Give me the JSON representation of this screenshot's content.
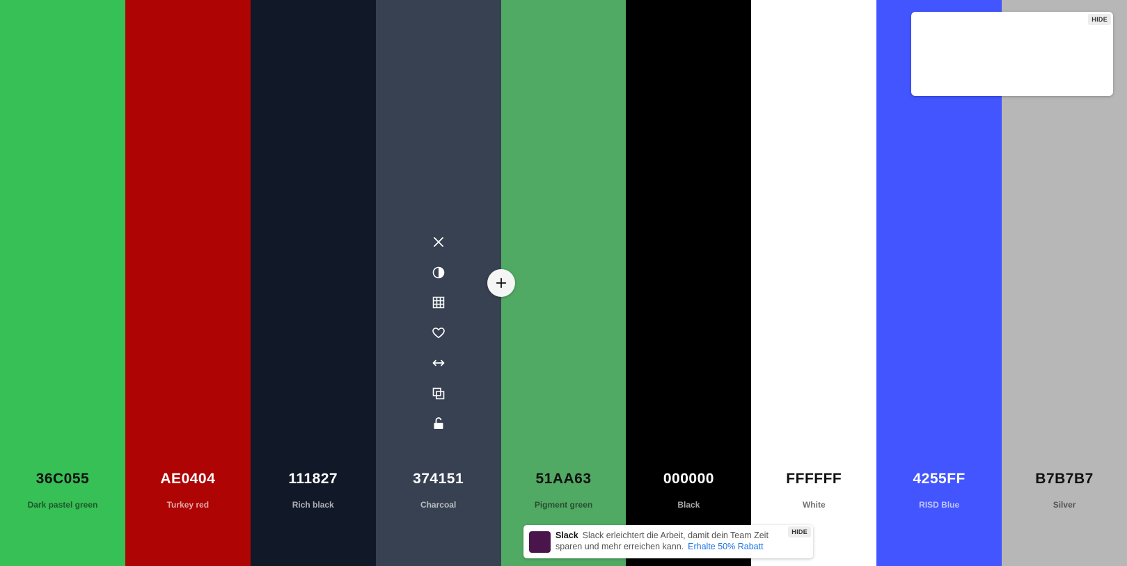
{
  "palette": {
    "swatches": [
      {
        "hex": "36C055",
        "name": "Dark pastel green",
        "color": "#36C055",
        "text": "dark"
      },
      {
        "hex": "AE0404",
        "name": "Turkey red",
        "color": "#AE0404",
        "text": "light"
      },
      {
        "hex": "111827",
        "name": "Rich black",
        "color": "#111827",
        "text": "light"
      },
      {
        "hex": "374151",
        "name": "Charcoal",
        "color": "#374151",
        "text": "light"
      },
      {
        "hex": "51AA63",
        "name": "Pigment green",
        "color": "#51AA63",
        "text": "dark"
      },
      {
        "hex": "000000",
        "name": "Black",
        "color": "#000000",
        "text": "light"
      },
      {
        "hex": "FFFFFF",
        "name": "White",
        "color": "#FFFFFF",
        "text": "dark"
      },
      {
        "hex": "4255FF",
        "name": "RISD Blue",
        "color": "#4255FF",
        "text": "light"
      },
      {
        "hex": "B7B7B7",
        "name": "Silver",
        "color": "#B7B7B7",
        "text": "dark"
      }
    ],
    "hovered_index": 3
  },
  "tools": [
    {
      "icon": "close-icon",
      "action": "remove"
    },
    {
      "icon": "contrast-icon",
      "action": "shades"
    },
    {
      "icon": "grid-icon",
      "action": "view-shades"
    },
    {
      "icon": "heart-icon",
      "action": "save"
    },
    {
      "icon": "arrows-horizontal-icon",
      "action": "drag"
    },
    {
      "icon": "copy-icon",
      "action": "copy"
    },
    {
      "icon": "lock-open-icon",
      "action": "lock"
    }
  ],
  "add_button": {
    "icon": "plus-icon"
  },
  "ad_card": {
    "hide_label": "HIDE"
  },
  "slack_ad": {
    "brand": "Slack",
    "text": "Slack erleichtert die Arbeit, damit dein Team Zeit sparen und mehr erreichen kann.",
    "cta": "Erhalte 50% Rabatt",
    "hide_label": "HIDE",
    "logo_color": "#4A154B"
  }
}
